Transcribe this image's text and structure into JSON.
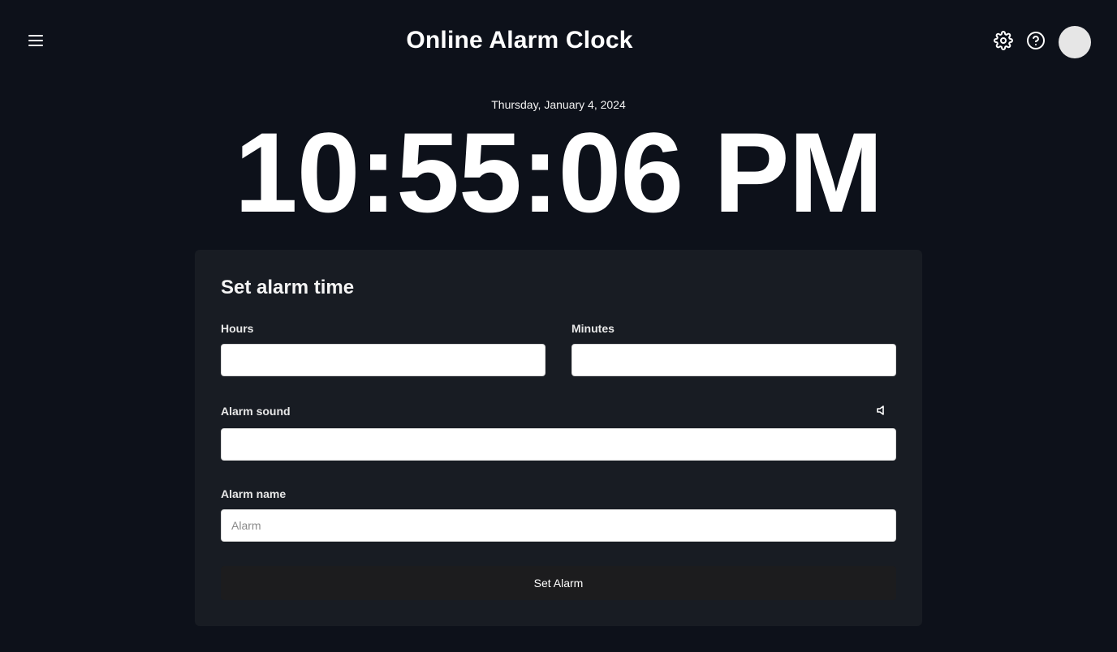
{
  "header": {
    "title": "Online Alarm Clock",
    "menu_icon": "hamburger-menu-icon",
    "settings_icon": "gear-icon",
    "help_icon": "question-circle-icon"
  },
  "clock": {
    "date": "Thursday, January 4, 2024",
    "time": "10:55:06 PM"
  },
  "alarm_form": {
    "title": "Set alarm time",
    "hours": {
      "label": "Hours",
      "value": ""
    },
    "minutes": {
      "label": "Minutes",
      "value": ""
    },
    "sound": {
      "label": "Alarm sound",
      "value": "",
      "icon": "speaker-icon"
    },
    "name": {
      "label": "Alarm name",
      "value": "",
      "placeholder": "Alarm"
    },
    "submit_label": "Set Alarm"
  },
  "colors": {
    "background": "#0d111a",
    "card": "#181c23",
    "button": "#1c1c1e",
    "text": "#ffffff"
  }
}
